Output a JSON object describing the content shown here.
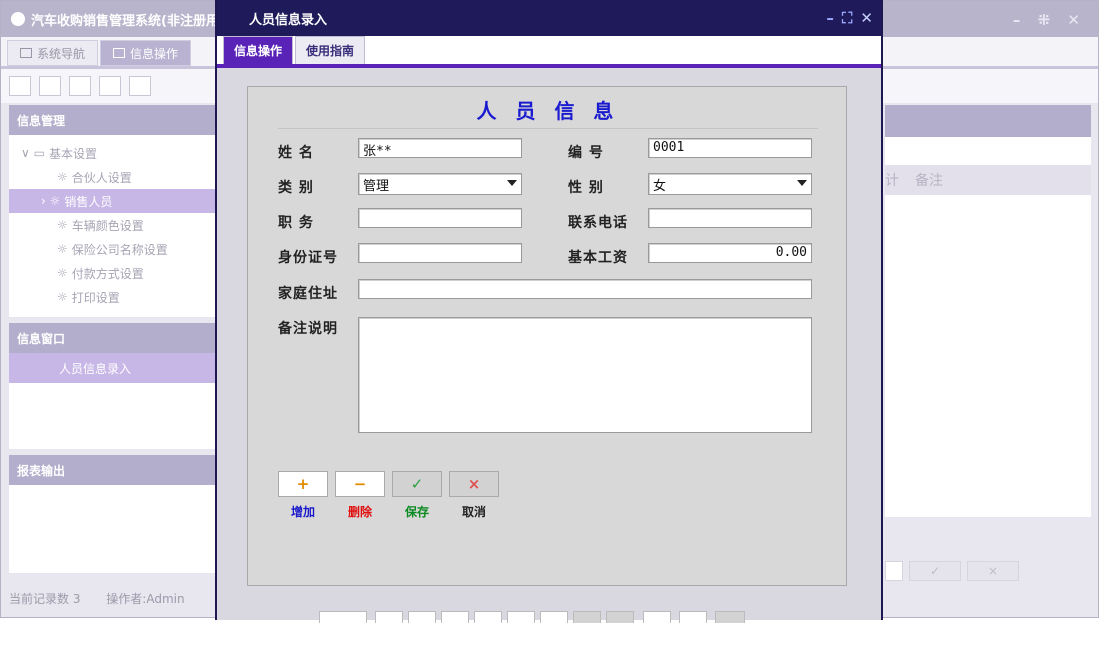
{
  "app": {
    "title": "汽车收购销售管理系统(非注册用",
    "tabs": [
      {
        "label": "系统导航"
      },
      {
        "label": "信息操作"
      }
    ],
    "panels": {
      "info_manage": "信息管理",
      "info_window": "信息窗口",
      "report_output": "报表输出"
    },
    "tree": {
      "root": "基本设置",
      "items": [
        "合伙人设置",
        "销售人员",
        "车辆颜色设置",
        "保险公司名称设置",
        "付款方式设置",
        "打印设置"
      ]
    },
    "window_items": [
      "人员信息录入"
    ],
    "status": {
      "record_count": "当前记录数 3",
      "operator": "操作者:Admin"
    },
    "grid_header_last": "备注",
    "grid_header_partial": "计"
  },
  "dialog": {
    "title": "人员信息录入",
    "tabs": [
      {
        "label": "信息操作"
      },
      {
        "label": "使用指南"
      }
    ],
    "form_title": "人 员 信 息",
    "labels": {
      "name": "姓 名",
      "code": "编 号",
      "category": "类 别",
      "gender": "性 别",
      "position": "职 务",
      "phone": "联系电话",
      "id_number": "身份证号",
      "base_salary": "基本工资",
      "address": "家庭住址",
      "remark": "备注说明"
    },
    "values": {
      "name": "张**",
      "code": "0001",
      "category": "管理",
      "gender": "女",
      "position": "",
      "phone": "",
      "id_number": "",
      "base_salary": "0.00",
      "address": "",
      "remark": ""
    },
    "buttons": {
      "add": {
        "label": "增加",
        "icon": "+",
        "color": "#1a1acc",
        "icon_color": "#e08a00"
      },
      "delete": {
        "label": "删除",
        "icon": "−",
        "color": "#e01010",
        "icon_color": "#e08a00"
      },
      "save": {
        "label": "保存",
        "icon": "✓",
        "color": "#0c8a22",
        "icon_color": "#2aa040"
      },
      "cancel": {
        "label": "取消",
        "icon": "×",
        "color": "#222222",
        "icon_color": "#e05050"
      }
    }
  }
}
